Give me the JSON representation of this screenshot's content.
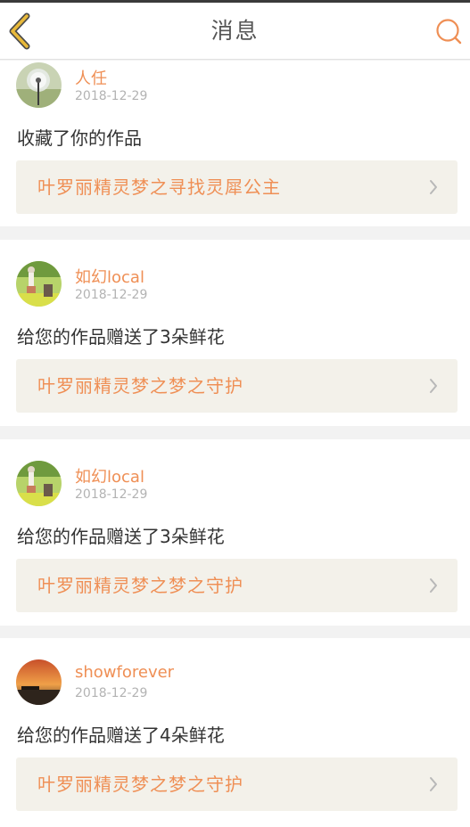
{
  "header": {
    "title": "消息",
    "back_icon": "chevron-left-icon",
    "search_icon": "search-icon",
    "accent_color": "#ef8f55",
    "back_color": "#e8b93a"
  },
  "messages": [
    {
      "username": "人任",
      "date": "2018-12-29",
      "action": "收藏了你的作品",
      "work_title": "叶罗丽精灵梦之寻找灵犀公主",
      "avatar": "dandelion-photo"
    },
    {
      "username": "如幻local",
      "date": "2018-12-29",
      "action": "给您的作品赠送了3朵鲜花",
      "work_title": "叶罗丽精灵梦之梦之守护",
      "avatar": "garden-figure-photo"
    },
    {
      "username": "如幻local",
      "date": "2018-12-29",
      "action": "给您的作品赠送了3朵鲜花",
      "work_title": "叶罗丽精灵梦之梦之守护",
      "avatar": "garden-figure-photo"
    },
    {
      "username": "showforever",
      "date": "2018-12-29",
      "action": "给您的作品赠送了4朵鲜花",
      "work_title": "叶罗丽精灵梦之梦之守护",
      "avatar": "sunset-photo"
    }
  ]
}
